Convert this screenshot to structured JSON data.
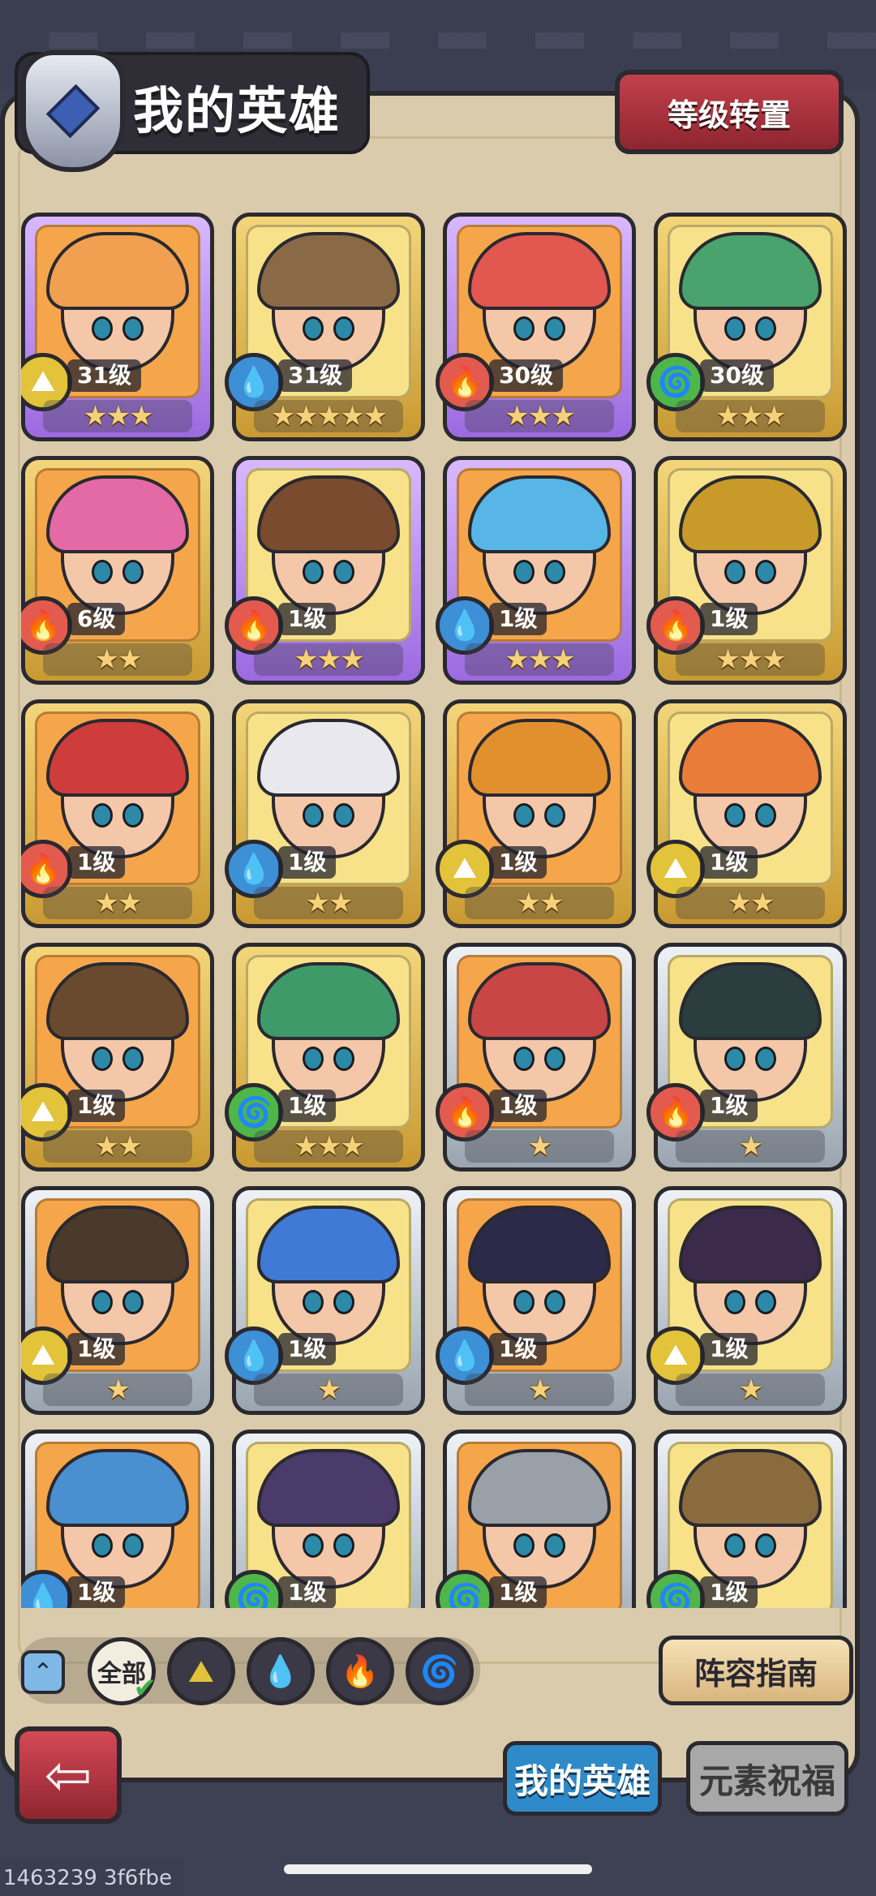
{
  "header": {
    "title": "我的英雄",
    "level_reset_label": "等级转置"
  },
  "elements": {
    "earth": "#e2c33a",
    "water": "#3d8fd6",
    "fire": "#e25b4e",
    "wind": "#4fb64a"
  },
  "heroes": [
    {
      "level": "31级",
      "stars": 3,
      "element": "earth",
      "frame": "purple",
      "hair": "#f0a050"
    },
    {
      "level": "31级",
      "stars": 5,
      "element": "water",
      "frame": "gold",
      "hair": "#8a6a46"
    },
    {
      "level": "30级",
      "stars": 3,
      "element": "fire",
      "frame": "purple",
      "hair": "#e2574f"
    },
    {
      "level": "30级",
      "stars": 3,
      "element": "wind",
      "frame": "gold",
      "hair": "#4aa36c"
    },
    {
      "level": "6级",
      "stars": 2,
      "element": "fire",
      "frame": "gold",
      "hair": "#e36aa4"
    },
    {
      "level": "1级",
      "stars": 3,
      "element": "fire",
      "frame": "purple",
      "hair": "#7b4b2f"
    },
    {
      "level": "1级",
      "stars": 3,
      "element": "water",
      "frame": "purple",
      "hair": "#58b6e6"
    },
    {
      "level": "1级",
      "stars": 3,
      "element": "fire",
      "frame": "gold",
      "hair": "#c79a2a"
    },
    {
      "level": "1级",
      "stars": 2,
      "element": "fire",
      "frame": "gold",
      "hair": "#cf3c3c"
    },
    {
      "level": "1级",
      "stars": 2,
      "element": "water",
      "frame": "gold",
      "hair": "#e8e8ee"
    },
    {
      "level": "1级",
      "stars": 2,
      "element": "earth",
      "frame": "gold",
      "hair": "#e2902e"
    },
    {
      "level": "1级",
      "stars": 2,
      "element": "earth",
      "frame": "gold",
      "hair": "#ea7c3a"
    },
    {
      "level": "1级",
      "stars": 2,
      "element": "earth",
      "frame": "gold",
      "hair": "#6a4a2e"
    },
    {
      "level": "1级",
      "stars": 3,
      "element": "wind",
      "frame": "gold",
      "hair": "#3f9a6a"
    },
    {
      "level": "1级",
      "stars": 1,
      "element": "fire",
      "frame": "silver",
      "hair": "#c94646"
    },
    {
      "level": "1级",
      "stars": 1,
      "element": "fire",
      "frame": "silver",
      "hair": "#2b3d3f"
    },
    {
      "level": "1级",
      "stars": 1,
      "element": "earth",
      "frame": "silver",
      "hair": "#4a3a2c"
    },
    {
      "level": "1级",
      "stars": 1,
      "element": "water",
      "frame": "silver",
      "hair": "#3f7ad6"
    },
    {
      "level": "1级",
      "stars": 1,
      "element": "water",
      "frame": "silver",
      "hair": "#2b2a48"
    },
    {
      "level": "1级",
      "stars": 1,
      "element": "earth",
      "frame": "silver",
      "hair": "#3b2a4a"
    },
    {
      "level": "1级",
      "stars": 0,
      "element": "water",
      "frame": "silver",
      "hair": "#4a8fd0"
    },
    {
      "level": "1级",
      "stars": 0,
      "element": "wind",
      "frame": "silver",
      "hair": "#4b3b6a"
    },
    {
      "level": "1级",
      "stars": 0,
      "element": "wind",
      "frame": "silver",
      "hair": "#9aa0a8"
    },
    {
      "level": "1级",
      "stars": 0,
      "element": "wind",
      "frame": "silver",
      "hair": "#8a6b3e"
    }
  ],
  "filters": {
    "collapse_icon": "chevron-up-icon",
    "all_label": "全部",
    "guide_label": "阵容指南"
  },
  "tabs": {
    "my_heroes": "我的英雄",
    "element_blessing": "元素祝福"
  },
  "footer_id": "1463239 3f6fbe"
}
